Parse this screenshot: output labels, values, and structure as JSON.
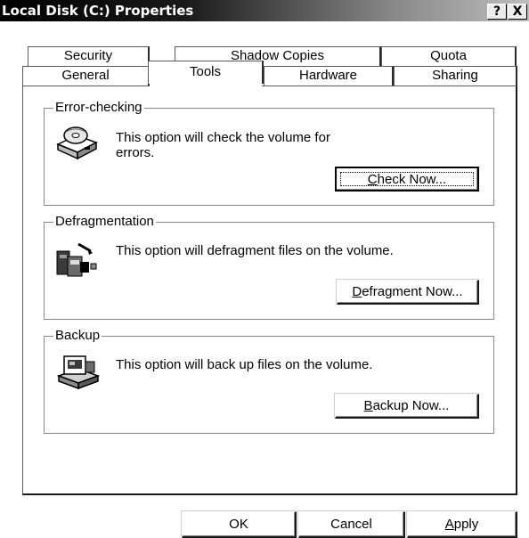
{
  "window": {
    "title": "Local Disk (C:) Properties",
    "help_glyph": "?",
    "close_glyph": "X"
  },
  "tabs_back": [
    "Security",
    "Shadow Copies",
    "Quota"
  ],
  "tabs_front": [
    "General",
    "Tools",
    "Hardware",
    "Sharing"
  ],
  "active_tab": "Tools",
  "groups": {
    "error_checking": {
      "title": "Error-checking",
      "description_line1": "This option will check the volume for",
      "description_line2": "errors.",
      "button": {
        "mnemonic": "C",
        "rest": "heck Now..."
      },
      "icon": "disk-check-icon"
    },
    "defragmentation": {
      "title": "Defragmentation",
      "description": "This option will defragment files on the volume.",
      "button": {
        "mnemonic": "D",
        "rest": "efragment Now..."
      },
      "icon": "defragment-icon"
    },
    "backup": {
      "title": "Backup",
      "description": "This option will back up files on the volume.",
      "button": {
        "mnemonic": "B",
        "rest": "ackup Now..."
      },
      "icon": "backup-icon"
    }
  },
  "footer": {
    "ok": "OK",
    "cancel": "Cancel",
    "apply_mnemonic": "A",
    "apply_rest": "pply"
  }
}
